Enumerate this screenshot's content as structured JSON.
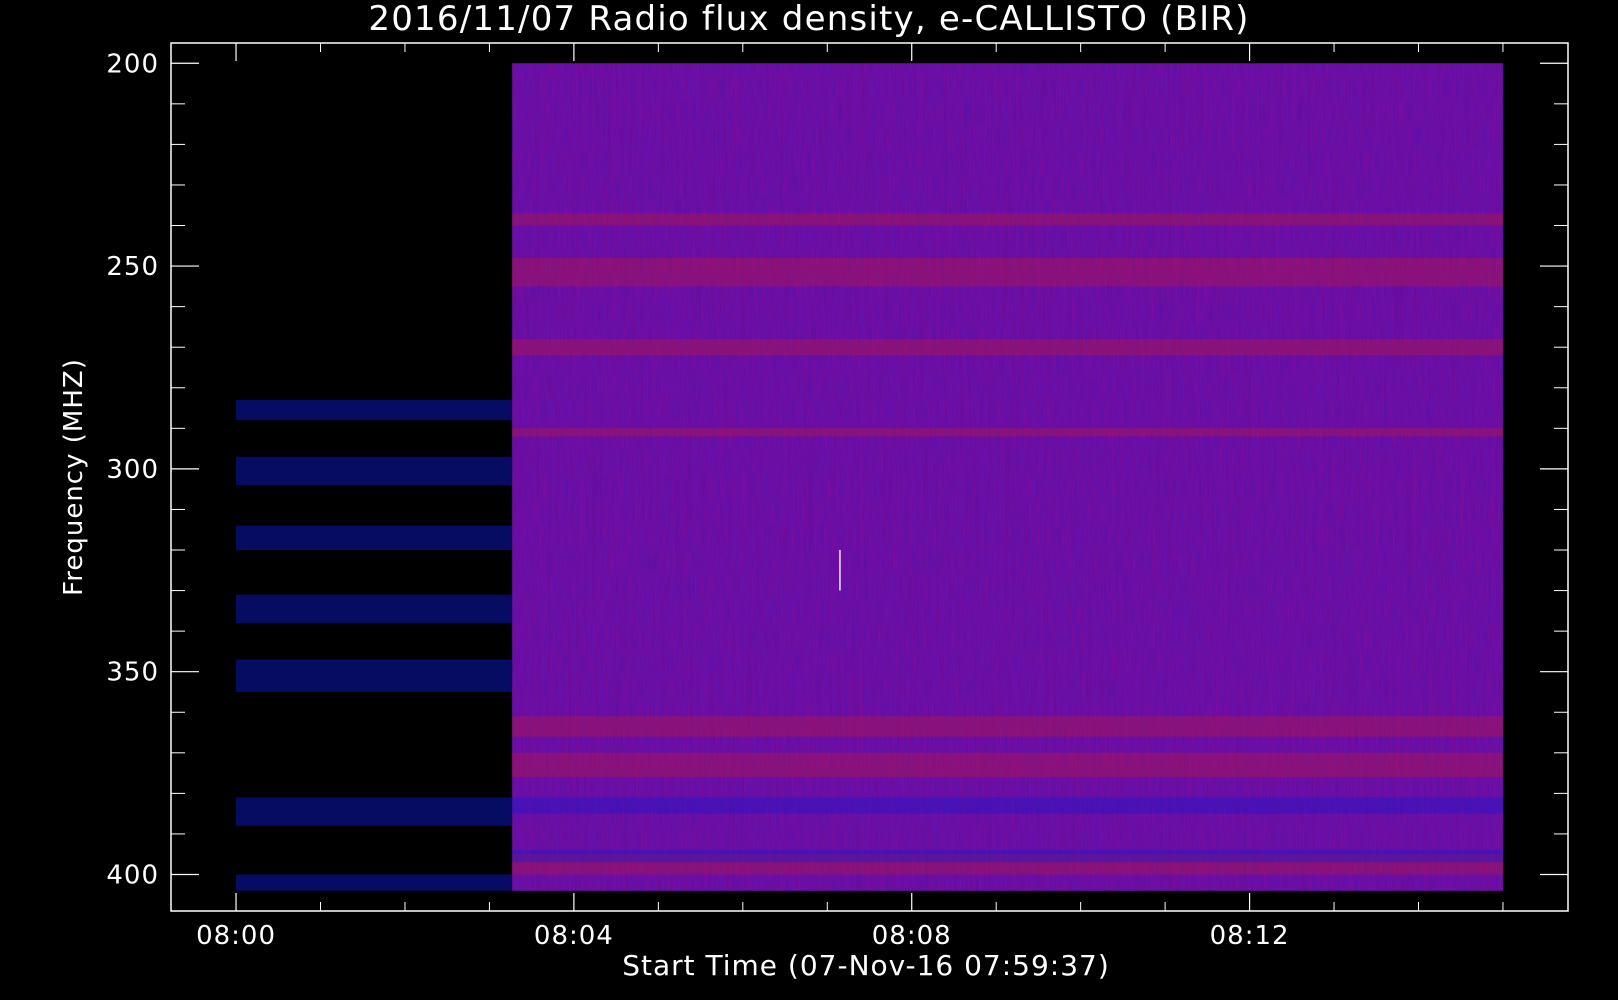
{
  "chart_data": {
    "type": "heatmap",
    "title": "2016/11/07  Radio flux density, e-CALLISTO (BIR)",
    "xlabel": "Start Time (07-Nov-16 07:59:37)",
    "ylabel": "Frequency (MHZ)",
    "x_tick_labels": [
      "08:00",
      "08:04",
      "08:08",
      "08:12"
    ],
    "x_tick_minutes": [
      0,
      4,
      8,
      12
    ],
    "y_tick_labels": [
      "200",
      "250",
      "300",
      "350",
      "400"
    ],
    "y_tick_values": [
      200,
      250,
      300,
      350,
      400
    ],
    "xlim_minutes": [
      -0.77,
      15.77
    ],
    "ylim": [
      195,
      409
    ],
    "data_extent": {
      "time_minutes": [
        0,
        15
      ],
      "freq_mhz": [
        200,
        404
      ],
      "observation_start_minutes": 3.27
    },
    "grid": false,
    "colors": {
      "background": "#000000",
      "frame": "#ffffff",
      "base": "#5a12b0",
      "low": "#0a1ad8",
      "high": "#c01a30"
    },
    "features": {
      "pre_observation_bands_mhz": [
        [
          283,
          288
        ],
        [
          297,
          304
        ],
        [
          314,
          320
        ],
        [
          331,
          338
        ],
        [
          347,
          355
        ],
        [
          381,
          388
        ],
        [
          400,
          404
        ]
      ],
      "red_band_freqs_mhz": [
        [
          237,
          240
        ],
        [
          248,
          255
        ],
        [
          268,
          272
        ],
        [
          290,
          292
        ],
        [
          395,
          400
        ],
        [
          370,
          376
        ],
        [
          361,
          366
        ]
      ],
      "blue_band_freqs_mhz": [
        [
          394,
          397
        ],
        [
          381,
          385
        ]
      ],
      "burst_mark": {
        "time_minutes": 7.15,
        "freq_mhz": [
          320,
          330
        ]
      }
    }
  }
}
